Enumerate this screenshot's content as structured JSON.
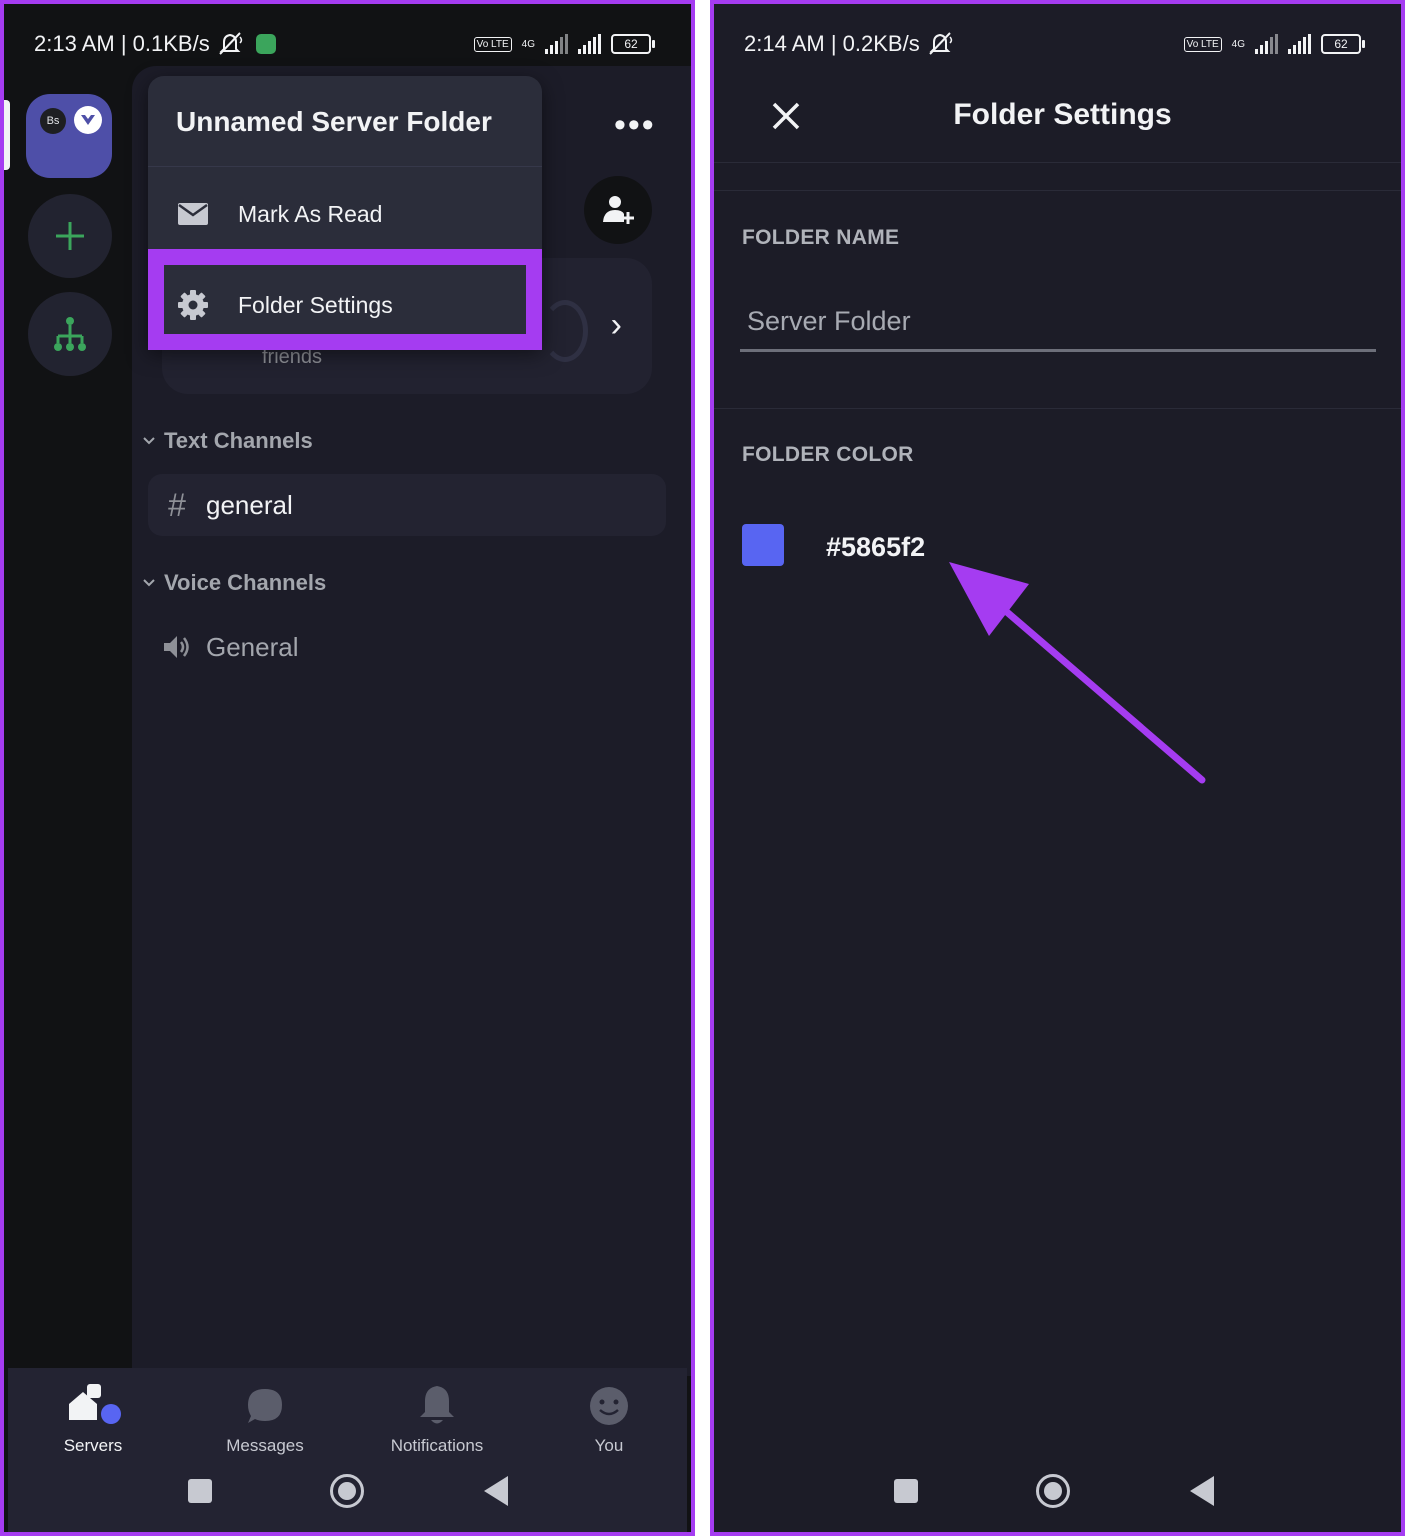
{
  "left": {
    "status": {
      "time": "2:13 AM | 0.1KB/s",
      "battery": "62",
      "volte": "Vo LTE",
      "network": "4G"
    },
    "rail": {
      "folder_badge": "Bs"
    },
    "menu": {
      "title": "Unnamed Server Folder",
      "items": [
        {
          "label": "Mark As Read",
          "icon": "envelope-icon"
        },
        {
          "label": "Folder Settings",
          "icon": "gear-icon"
        }
      ]
    },
    "card": {
      "friends_text": "friends"
    },
    "categories": {
      "text": "Text Channels",
      "voice": "Voice Channels"
    },
    "channels": {
      "text": [
        {
          "name": "general",
          "icon": "hash-icon"
        }
      ],
      "voice": [
        {
          "name": "General",
          "icon": "speaker-icon"
        }
      ]
    },
    "tabs": [
      {
        "label": "Servers",
        "icon": "servers-icon"
      },
      {
        "label": "Messages",
        "icon": "chat-bubble-icon"
      },
      {
        "label": "Notifications",
        "icon": "bell-icon"
      },
      {
        "label": "You",
        "icon": "smiley-icon"
      }
    ]
  },
  "right": {
    "status": {
      "time": "2:14 AM | 0.2KB/s",
      "battery": "62",
      "volte": "Vo LTE",
      "network": "4G"
    },
    "title": "Folder Settings",
    "folder_name_label": "FOLDER NAME",
    "folder_name_placeholder": "Server Folder",
    "folder_color_label": "FOLDER COLOR",
    "folder_color_value": "#5865f2"
  },
  "colors": {
    "accent_highlight": "#a53cf1",
    "folder_color": "#5865f2",
    "add_server_green": "#3ba55c",
    "background": "#1c1c27"
  }
}
